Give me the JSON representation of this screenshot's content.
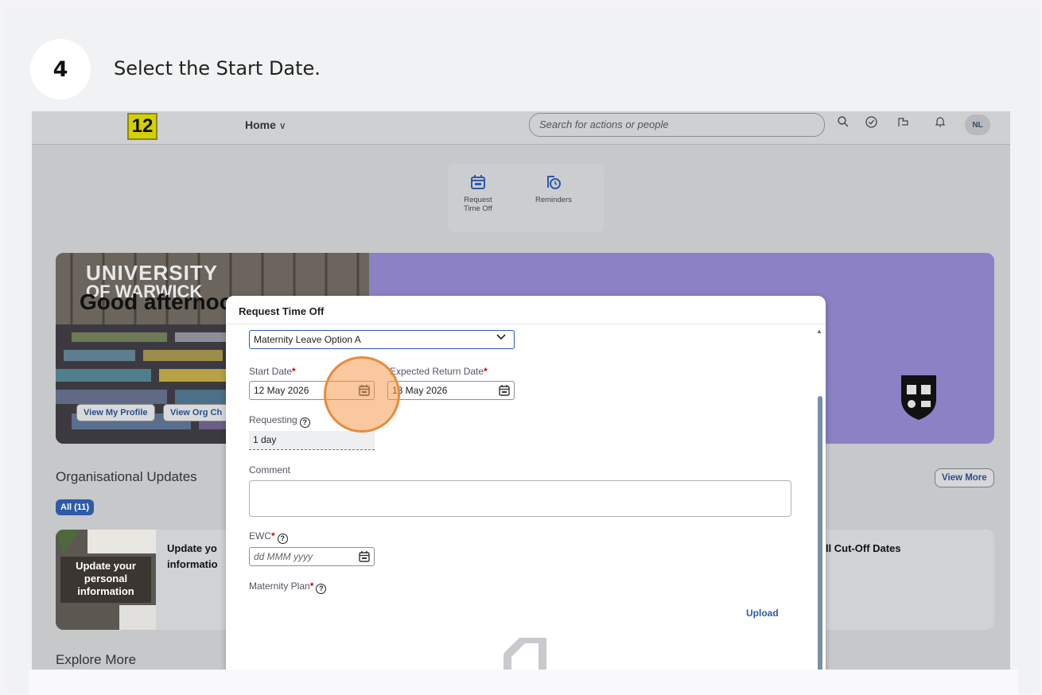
{
  "guide": {
    "step_number": "4",
    "instruction": "Select the Start Date."
  },
  "topbar": {
    "logo_text": "12",
    "home_label": "Home",
    "search_placeholder": "Search for actions or people",
    "avatar_initials": "NL"
  },
  "quick_actions": [
    {
      "label_line1": "Request",
      "label_line2": "Time Off"
    },
    {
      "label_line1": "Reminders",
      "label_line2": ""
    }
  ],
  "banner": {
    "university_line1": "UNIVERSITY",
    "university_line2": "OF WARWICK",
    "greeting": "Good afternoo",
    "view_profile": "View My Profile",
    "view_org": "View Org Ch"
  },
  "org_updates": {
    "title": "Organisational Updates",
    "filter_chip": "All (11)",
    "view_more": "View More",
    "card": {
      "thumb_text": "Update your personal information",
      "title_line1": "Update yo",
      "title_line2": "informatio",
      "right_title": "oll Cut-Off Dates"
    }
  },
  "explore": {
    "title": "Explore More"
  },
  "dialog": {
    "title": "Request Time Off",
    "time_type": "Maternity Leave Option A",
    "start_date_label": "Start Date",
    "start_date_value": "12 May 2026",
    "return_date_label": "Expected Return Date",
    "return_date_value": "13 May 2026",
    "requesting_label": "Requesting",
    "requesting_value": "1 day",
    "comment_label": "Comment",
    "comment_value": "",
    "ewc_label": "EWC",
    "ewc_placeholder": "dd MMM yyyy",
    "maternity_plan_label": "Maternity Plan",
    "upload_label": "Upload"
  },
  "colors": {
    "accent": "#2e5aa8",
    "banner_purple": "#8b81c4",
    "highlight": "#f5a05a"
  }
}
